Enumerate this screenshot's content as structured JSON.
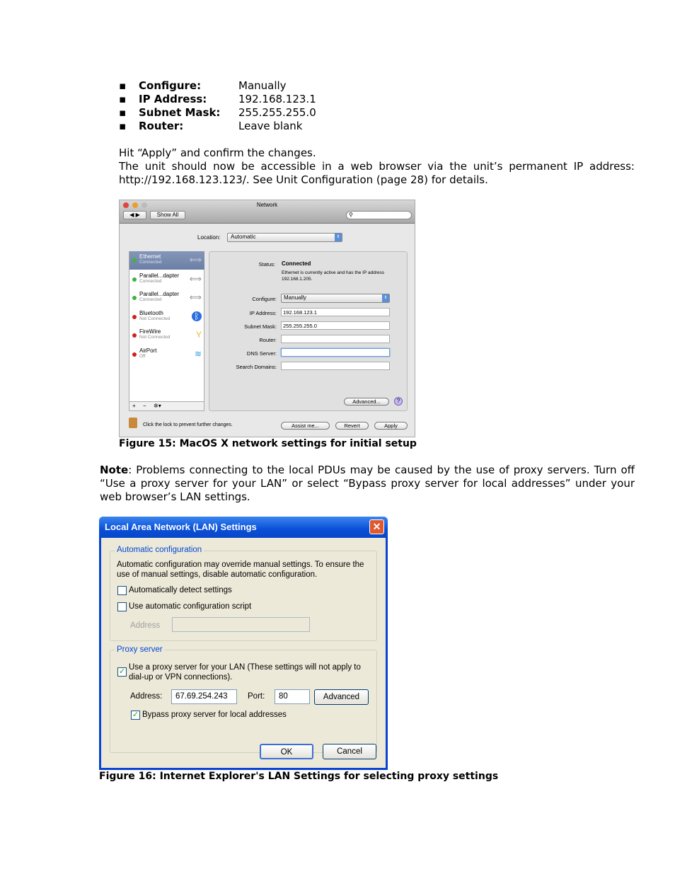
{
  "settings_list": [
    {
      "label": "Configure:",
      "value": "Manually"
    },
    {
      "label": "IP Address:",
      "value": "192.168.123.1"
    },
    {
      "label": "Subnet Mask:",
      "value": "255.255.255.0"
    },
    {
      "label": "Router:",
      "value": "Leave blank"
    }
  ],
  "para1": "Hit “Apply” and confirm the changes.",
  "para2": "The unit should now be accessible in a web browser via the unit’s permanent IP address: http://192.168.123.123/.  See Unit Configuration (page 28) for details.",
  "mac": {
    "title": "Network",
    "show_all": "Show All",
    "location_label": "Location:",
    "location_value": "Automatic",
    "services": [
      {
        "name": "Ethernet",
        "status": "Connected",
        "led": "#3cb43c",
        "icon": "⟺"
      },
      {
        "name": "Parallel...dapter",
        "status": "Connected",
        "led": "#3cb43c",
        "icon": "⟺"
      },
      {
        "name": "Parallel...dapter",
        "status": "Connected",
        "led": "#3cb43c",
        "icon": "⟺"
      },
      {
        "name": "Bluetooth",
        "status": "Not Connected",
        "led": "#d21e1e",
        "icon": "ᛒ"
      },
      {
        "name": "FireWire",
        "status": "Not Connected",
        "led": "#d21e1e",
        "icon": "Y"
      },
      {
        "name": "AirPort",
        "status": "Off",
        "led": "#d21e1e",
        "icon": "≋"
      }
    ],
    "status_label": "Status:",
    "status_value": "Connected",
    "status_desc": "Ethernet is currently active and has the IP address 192.168.1.205.",
    "configure_label": "Configure:",
    "configure_value": "Manually",
    "ip_label": "IP Address:",
    "ip_value": "192.168.123.1",
    "subnet_label": "Subnet Mask:",
    "subnet_value": "255.255.255.0",
    "router_label": "Router:",
    "router_value": "",
    "dns_label": "DNS Server:",
    "dns_value": "",
    "search_label": "Search Domains:",
    "search_value": "",
    "advanced": "Advanced...",
    "help": "?",
    "add": "+",
    "remove": "−",
    "gear": "✲▾",
    "lock_text": "Click the lock to prevent further changes.",
    "assist": "Assist me...",
    "revert": "Revert",
    "apply": "Apply"
  },
  "caption15": "Figure 15: MacOS X network settings for initial setup",
  "note_label": "Note",
  "note_text": ": Problems connecting to the local PDUs may be caused by the use of proxy servers.  Turn off “Use a proxy server for your LAN” or select “Bypass proxy server for local addresses” under your web browser’s LAN settings.",
  "ie": {
    "title": "Local Area Network (LAN) Settings",
    "auto_group": "Automatic configuration",
    "auto_desc": "Automatic configuration may override manual settings.  To ensure the use of manual settings, disable automatic configuration.",
    "auto_detect": "Automatically detect settings",
    "auto_detect_checked": false,
    "auto_script": "Use automatic configuration script",
    "auto_script_checked": false,
    "address_label": "Address",
    "address_value": "",
    "proxy_group": "Proxy server",
    "use_proxy": "Use a proxy server for your LAN (These settings will not apply to dial-up or VPN connections).",
    "use_proxy_checked": true,
    "proxy_address_label": "Address:",
    "proxy_address": "67.69.254.243",
    "port_label": "Port:",
    "port": "80",
    "advanced": "Advanced",
    "bypass": "Bypass proxy server for local addresses",
    "bypass_checked": true,
    "ok": "OK",
    "cancel": "Cancel"
  },
  "caption16": "Figure 16: Internet Explorer's LAN Settings for selecting proxy settings"
}
